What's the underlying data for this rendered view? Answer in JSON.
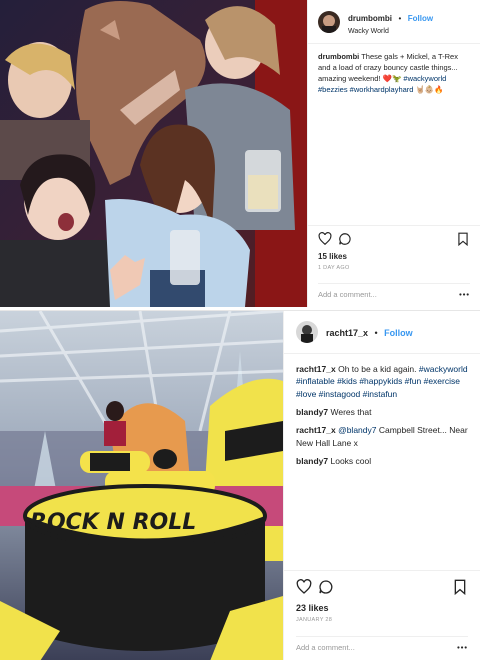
{
  "post1": {
    "username": "drumbombi",
    "dot": "•",
    "follow": "Follow",
    "location": "Wacky World",
    "caption_user": "drumbombi",
    "caption_text": "These gals + Mickel, a T-Rex and a load of crazy bouncy castle things... amazing weekend! ❤️🦖",
    "caption_tags": "#wackyworld #bezzies #workhardplayhard",
    "caption_emoji": "🤘🏼👶🏼🔥",
    "likes": "15 likes",
    "date": "1 DAY AGO",
    "add_comment": "Add a comment...",
    "more": "•••",
    "icons": [
      "heart-icon",
      "comment-icon",
      "save-icon"
    ]
  },
  "post2": {
    "username": "racht17_x",
    "dot": "•",
    "follow": "Follow",
    "caption_user": "racht17_x",
    "caption_text": "Oh to be a kid again.",
    "caption_tags": "#wackyworld #inflatable #kids #happykids #fun #exercise #love #instagood #instafun",
    "comments": [
      {
        "user": "blandy7",
        "text": "Weres that"
      },
      {
        "user": "racht17_x",
        "mention": "@blandy7",
        "text": "Campbell Street... Near New Hall Lane x"
      },
      {
        "user": "blandy7",
        "text": "Looks cool"
      }
    ],
    "likes": "23 likes",
    "date": "JANUARY 28",
    "add_comment": "Add a comment...",
    "more": "•••",
    "banner_text": "ROCK N ROLL",
    "icons": [
      "heart-icon",
      "comment-icon",
      "save-icon"
    ]
  }
}
